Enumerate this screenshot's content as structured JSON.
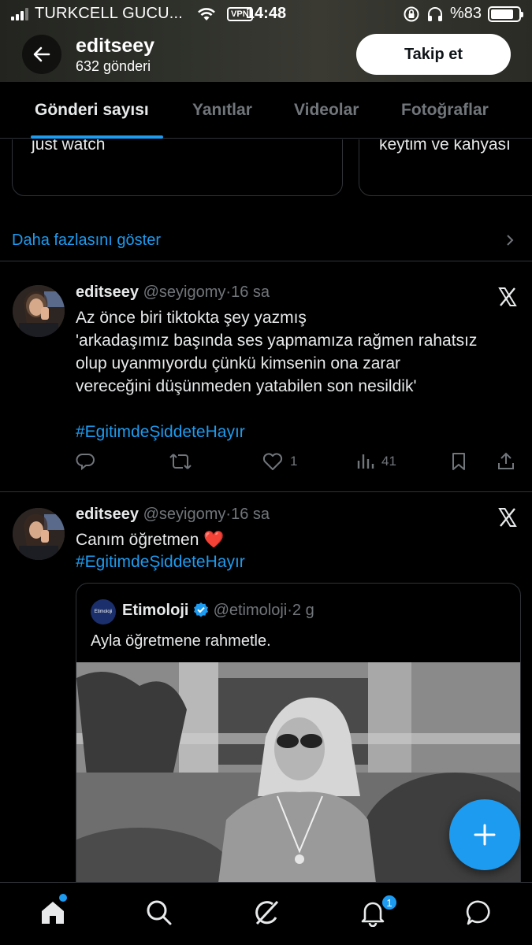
{
  "status_bar": {
    "carrier": "TURKCELL GUCU...",
    "vpn": "VPN",
    "time": "14:48",
    "battery": "%83",
    "battery_level": 0.83
  },
  "profile": {
    "name": "editseey",
    "posts": "632 gönderi",
    "follow_label": "Takip et"
  },
  "tabs": [
    {
      "label": "Gönderi sayısı",
      "active": true
    },
    {
      "label": "Yanıtlar",
      "active": false
    },
    {
      "label": "Videolar",
      "active": false
    },
    {
      "label": "Fotoğraflar",
      "active": false
    }
  ],
  "cards": [
    {
      "text": "just watch"
    },
    {
      "text": "keytim ve kahyası"
    }
  ],
  "show_more": "Daha fazlasını göster",
  "tweets": [
    {
      "name": "editseey",
      "handle": "@seyigomy",
      "dot": "·",
      "time": "16 sa",
      "lines": [
        "Az önce biri tiktokta şey yazmış",
        "'arkadaşımız başında ses yapmamıza rağmen rahatsız",
        "olup uyanmıyordu çünkü kimsenin ona zarar",
        "vereceğini düşünmeden yatabilen son nesildik'"
      ],
      "hashtag": "#EgitimdeŞiddeteHayır",
      "likes": "1",
      "views": "41"
    },
    {
      "name": "editseey",
      "handle": "@seyigomy",
      "dot": "·",
      "time": "16 sa",
      "text": "Canım öğretmen ❤️",
      "hashtag": "#EgitimdeŞiddeteHayır",
      "quote": {
        "avatar_text": "Etimoloji",
        "name": "Etimoloji",
        "handle": "@etimoloji",
        "dot": "·",
        "time": "2 g",
        "text": "Ayla öğretmene rahmetle."
      }
    }
  ],
  "bottom_nav": {
    "notif_count": "1"
  },
  "colors": {
    "accent": "#1d9bf0",
    "background": "#000000",
    "text": "#e7e9ea",
    "muted": "#71767b",
    "border": "#2f3336"
  }
}
